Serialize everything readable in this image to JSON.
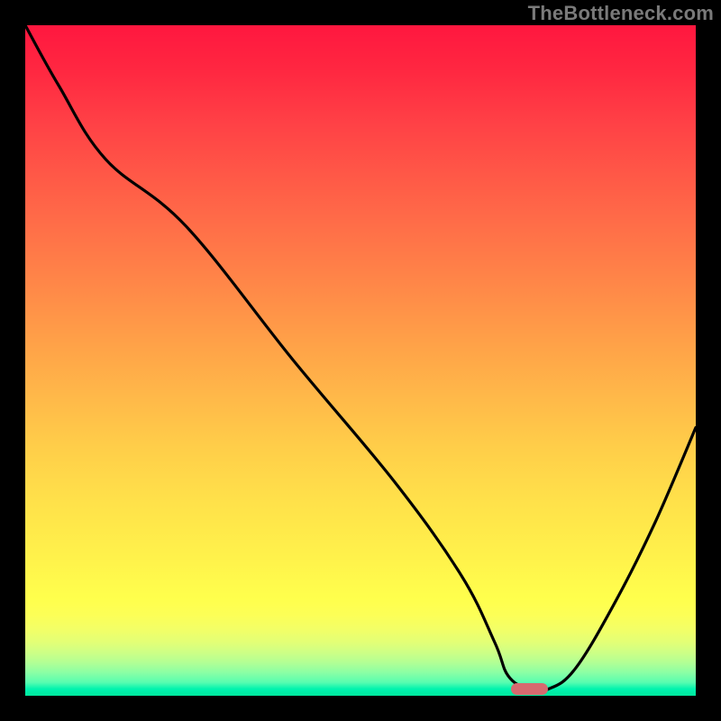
{
  "watermark": "TheBottleneck.com",
  "colors": {
    "frame": "#000000",
    "curve": "#000000",
    "marker": "#d66a6f"
  },
  "chart_data": {
    "type": "line",
    "title": "",
    "xlabel": "",
    "ylabel": "",
    "xlim": [
      0,
      100
    ],
    "ylim": [
      0,
      100
    ],
    "grid": false,
    "legend": false,
    "series": [
      {
        "name": "bottleneck-curve",
        "x": [
          0,
          5,
          12,
          24,
          40,
          55,
          65,
          70,
          72,
          75,
          78,
          82,
          88,
          94,
          100
        ],
        "values": [
          100,
          91,
          80,
          70,
          50,
          32,
          18,
          8,
          3,
          1,
          1,
          4,
          14,
          26,
          40
        ]
      }
    ],
    "marker": {
      "x_start": 72.5,
      "x_end": 78,
      "y": 1
    },
    "gradient_stops": [
      {
        "pct": 0,
        "color": "#ff173f"
      },
      {
        "pct": 50,
        "color": "#ffa949"
      },
      {
        "pct": 85,
        "color": "#ffff4c"
      },
      {
        "pct": 100,
        "color": "#00e89d"
      }
    ]
  }
}
